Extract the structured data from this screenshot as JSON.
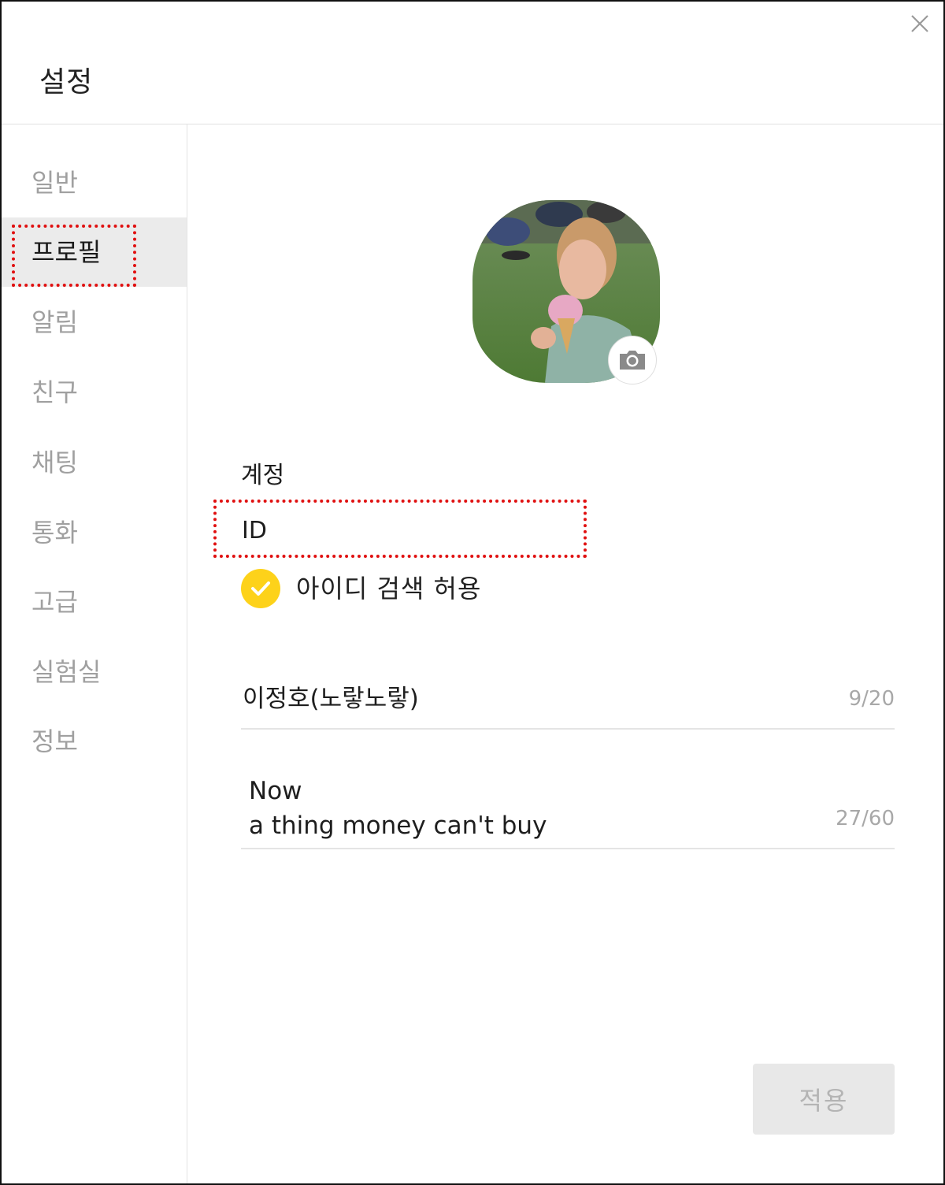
{
  "window": {
    "title": "설정"
  },
  "sidebar": {
    "items": [
      {
        "label": "일반",
        "active": false
      },
      {
        "label": "프로필",
        "active": true
      },
      {
        "label": "알림",
        "active": false
      },
      {
        "label": "친구",
        "active": false
      },
      {
        "label": "채팅",
        "active": false
      },
      {
        "label": "통화",
        "active": false
      },
      {
        "label": "고급",
        "active": false
      },
      {
        "label": "실험실",
        "active": false
      },
      {
        "label": "정보",
        "active": false
      }
    ]
  },
  "profile": {
    "account_label": "계정",
    "id_value": "ID",
    "allow_id_search": {
      "label": "아이디 검색 허용",
      "checked": true
    },
    "name_field": {
      "value": "이정호(노랗노랗)",
      "counter": "9/20"
    },
    "status_field": {
      "line1": "Now",
      "line2": "a thing money can't buy",
      "counter": "27/60"
    },
    "apply_label": "적용"
  },
  "colors": {
    "accent": "#fdd21a",
    "highlight": "#e01010",
    "active_bg": "#ebebeb"
  },
  "icons": {
    "close": "close-icon",
    "camera": "camera-icon",
    "check": "check-icon"
  }
}
